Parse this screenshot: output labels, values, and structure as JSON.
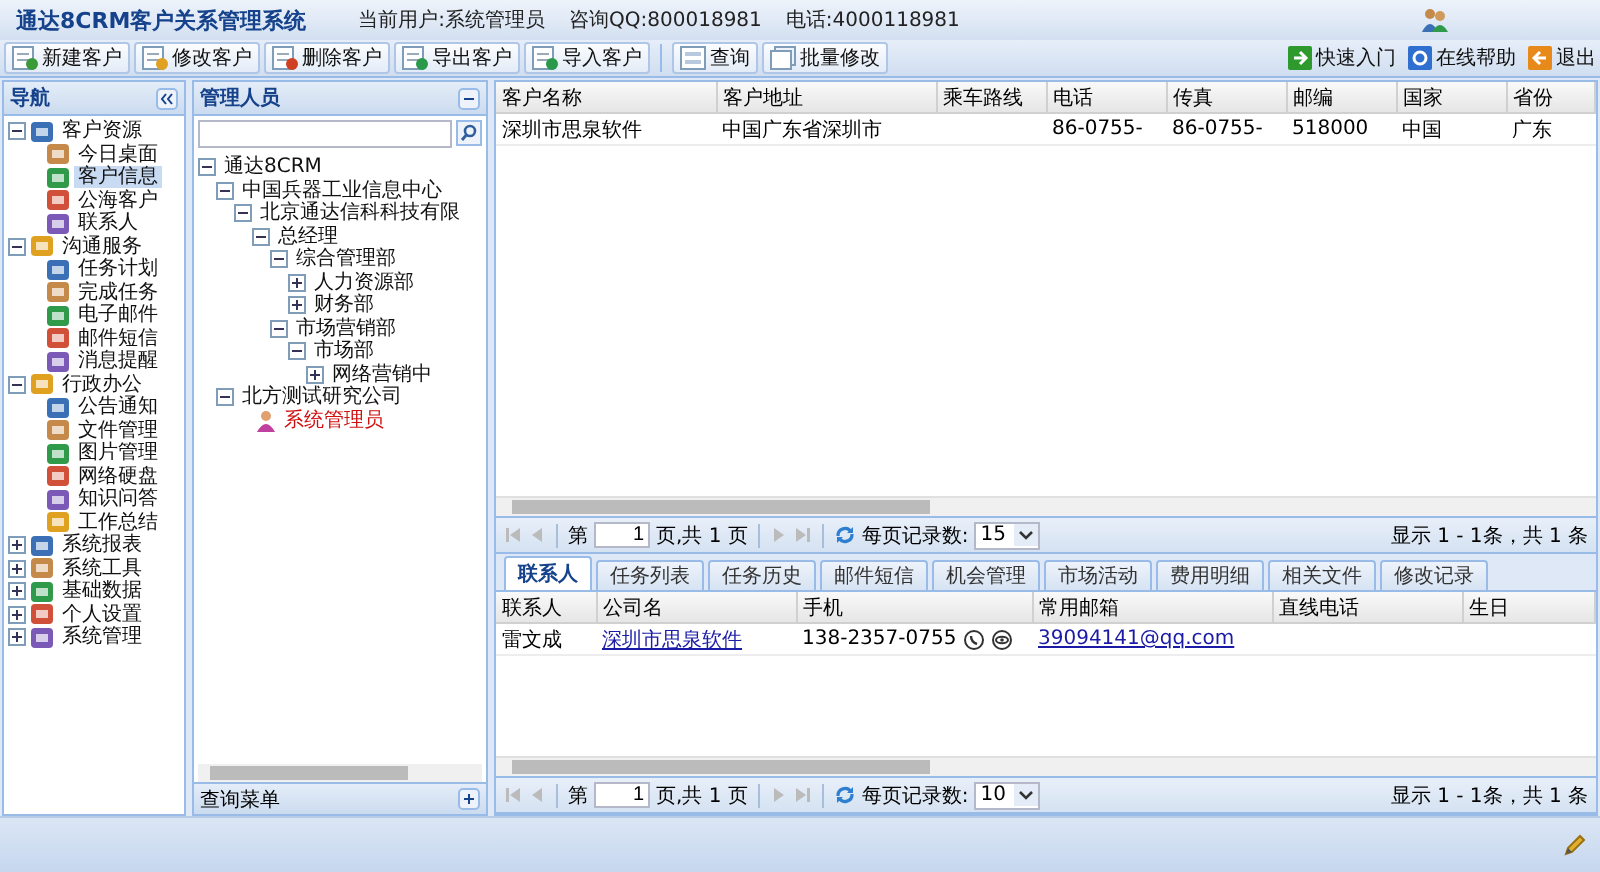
{
  "header": {
    "title": "通达8CRM客户关系管理系统",
    "current_user": "当前用户:系统管理员",
    "hotline": "咨询QQ:800018981",
    "phone": "电话:4000118981"
  },
  "toolbar": {
    "buttons": [
      {
        "label": "新建客户",
        "kind": "new"
      },
      {
        "label": "修改客户",
        "kind": "edit"
      },
      {
        "label": "删除客户",
        "kind": "delete"
      },
      {
        "label": "导出客户",
        "kind": "export"
      },
      {
        "label": "导入客户",
        "kind": "import"
      }
    ],
    "query_buttons": [
      {
        "label": "查询",
        "kind": "query"
      },
      {
        "label": "批量修改",
        "kind": "batch"
      }
    ],
    "links": [
      {
        "label": "快速入门",
        "kind": "start"
      },
      {
        "label": "在线帮助",
        "kind": "help"
      },
      {
        "label": "退出",
        "kind": "exit"
      }
    ]
  },
  "nav": {
    "title": "导航",
    "items": [
      {
        "label": "客户资源",
        "expanded": true,
        "children": [
          {
            "label": "今日桌面",
            "selected": false
          },
          {
            "label": "客户信息",
            "selected": true
          },
          {
            "label": "公海客户",
            "selected": false
          },
          {
            "label": "联系人",
            "selected": false
          }
        ]
      },
      {
        "label": "沟通服务",
        "expanded": true,
        "children": [
          {
            "label": "任务计划",
            "selected": false
          },
          {
            "label": "完成任务",
            "selected": false
          },
          {
            "label": "电子邮件",
            "selected": false
          },
          {
            "label": "邮件短信",
            "selected": false
          },
          {
            "label": "消息提醒",
            "selected": false
          }
        ]
      },
      {
        "label": "行政办公",
        "expanded": true,
        "children": [
          {
            "label": "公告通知",
            "selected": false
          },
          {
            "label": "文件管理",
            "selected": false
          },
          {
            "label": "图片管理",
            "selected": false
          },
          {
            "label": "网络硬盘",
            "selected": false
          },
          {
            "label": "知识问答",
            "selected": false
          },
          {
            "label": "工作总结",
            "selected": false
          }
        ]
      },
      {
        "label": "系统报表",
        "expanded": false
      },
      {
        "label": "系统工具",
        "expanded": false
      },
      {
        "label": "基础数据",
        "expanded": false
      },
      {
        "label": "个人设置",
        "expanded": false
      },
      {
        "label": "系统管理",
        "expanded": false
      }
    ]
  },
  "admin": {
    "title": "管理人员",
    "footer": "查询菜单",
    "tree": [
      {
        "label": "通达8CRM",
        "expanded": true,
        "children": [
          {
            "label": "中国兵器工业信息中心",
            "expanded": true,
            "children": [
              {
                "label": "北京通达信科科技有限",
                "expanded": true,
                "children": [
                  {
                    "label": "总经理",
                    "expanded": true,
                    "children": [
                      {
                        "label": "综合管理部",
                        "expanded": true,
                        "children": [
                          {
                            "label": "人力资源部",
                            "expanded": false
                          },
                          {
                            "label": "财务部",
                            "expanded": false
                          }
                        ]
                      },
                      {
                        "label": "市场营销部",
                        "expanded": true,
                        "children": [
                          {
                            "label": "市场部",
                            "expanded": true,
                            "children": [
                              {
                                "label": "网络营销中",
                                "expanded": false
                              }
                            ]
                          }
                        ]
                      }
                    ]
                  }
                ]
              }
            ]
          },
          {
            "label": "北方测试研究公司",
            "expanded": true,
            "children": [
              {
                "label": "系统管理员",
                "kind": "user"
              }
            ]
          }
        ]
      }
    ]
  },
  "customer_grid": {
    "columns": [
      "客户名称",
      "客户地址",
      "乘车路线",
      "电话",
      "传真",
      "邮编",
      "国家",
      "省份"
    ],
    "rows": [
      {
        "cells": [
          "深圳市思泉软件",
          "中国广东省深圳市",
          null,
          "86-0755-",
          "86-0755-",
          "518000",
          "中国",
          "广东"
        ]
      }
    ]
  },
  "customer_pager": {
    "page_prefix": "第",
    "page": "1",
    "page_suffix": "页,共 1 页",
    "per_page_label": "每页记录数:",
    "per_page": "15",
    "summary": "显示 1 - 1条，共 1 条"
  },
  "tabs": [
    {
      "label": "联系人",
      "selected": true
    },
    {
      "label": "任务列表",
      "selected": false
    },
    {
      "label": "任务历史",
      "selected": false
    },
    {
      "label": "邮件短信",
      "selected": false
    },
    {
      "label": "机会管理",
      "selected": false
    },
    {
      "label": "市场活动",
      "selected": false
    },
    {
      "label": "费用明细",
      "selected": false
    },
    {
      "label": "相关文件",
      "selected": false
    },
    {
      "label": "修改记录",
      "selected": false
    }
  ],
  "contact_grid": {
    "columns": [
      "联系人",
      "公司名",
      "手机",
      "常用邮箱",
      "直线电话",
      "生日"
    ],
    "rows": [
      {
        "cells": [
          {
            "kind": "text",
            "text": "雷文成"
          },
          {
            "kind": "link",
            "text": "深圳市思泉软件"
          },
          {
            "kind": "phone",
            "text": "138-2357-0755"
          },
          {
            "kind": "link",
            "text": "39094141@qq.com"
          },
          null,
          null
        ]
      }
    ]
  },
  "contact_pager": {
    "page_prefix": "第",
    "page": "1",
    "page_suffix": "页,共 1 页",
    "per_page_label": "每页记录数:",
    "per_page": "10",
    "summary": "显示 1 - 1条，共 1 条"
  }
}
